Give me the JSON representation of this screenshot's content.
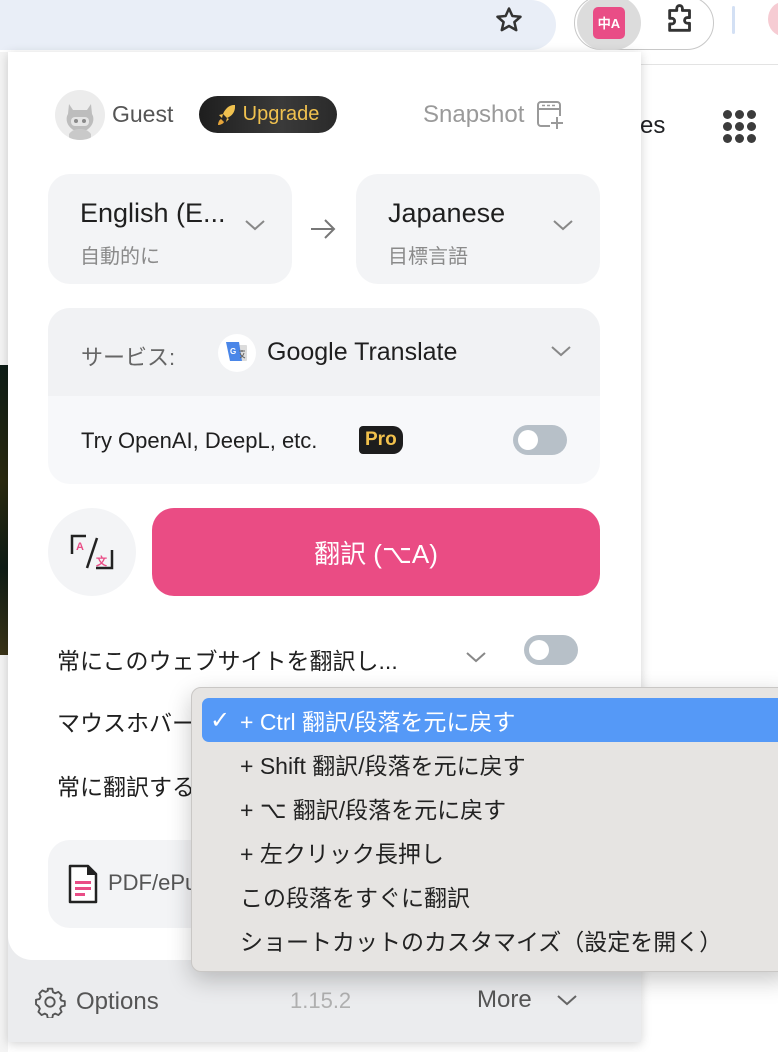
{
  "browser": {
    "star_icon": "star-outline",
    "extension_icon": "translate-extension",
    "extension_icon_text": "中A",
    "puzzle_icon": "extensions-puzzle",
    "background_text": "es"
  },
  "header": {
    "user_name": "Guest",
    "upgrade_label": "Upgrade",
    "snapshot_label": "Snapshot"
  },
  "languages": {
    "source": {
      "name": "English (E...",
      "sub": "自動的に"
    },
    "target": {
      "name": "Japanese",
      "sub": "目標言語"
    }
  },
  "service": {
    "label": "サービス:",
    "name": "Google Translate",
    "try_text": "Try OpenAI, DeepL, etc.",
    "pro_badge": "Pro",
    "try_enabled": false
  },
  "actions": {
    "translate_label": "翻訳 (⌥A)"
  },
  "settings": {
    "always_site_label": "常にこのウェブサイトを翻訳し...",
    "always_site_enabled": false,
    "mouse_hover_label": "マウスホバー",
    "always_translate_label": "常に翻訳する"
  },
  "pdf": {
    "label": "PDF/ePub"
  },
  "footer": {
    "options_label": "Options",
    "version": "1.15.2",
    "more_label": "More"
  },
  "menu": {
    "items": [
      {
        "label": "+ Ctrl 翻訳/段落を元に戻す",
        "selected": true,
        "check": "✓"
      },
      {
        "label": "+ Shift 翻訳/段落を元に戻す",
        "selected": false,
        "check": ""
      },
      {
        "label": "+ ⌥ 翻訳/段落を元に戻す",
        "selected": false,
        "check": ""
      },
      {
        "label": "+ 左クリック長押し",
        "selected": false,
        "check": ""
      },
      {
        "label": "この段落をすぐに翻訳",
        "selected": false,
        "check": ""
      },
      {
        "label": "ショートカットのカスタマイズ（設定を開く）",
        "selected": false,
        "check": ""
      }
    ]
  },
  "colors": {
    "accent": "#ea4c84",
    "menu_highlight": "#5599f7",
    "pro_gold": "#f2c14c"
  }
}
